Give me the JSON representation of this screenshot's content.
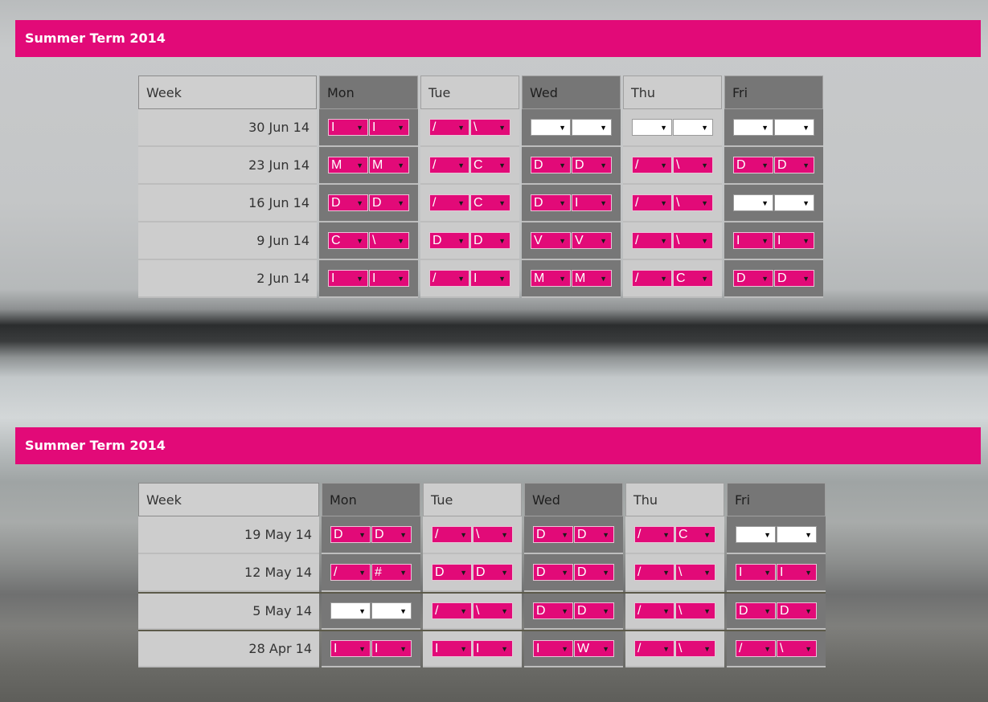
{
  "tables": [
    {
      "title": "Summer Term 2014",
      "headers": {
        "week": "Week",
        "days": [
          "Mon",
          "Tue",
          "Wed",
          "Thu",
          "Fri"
        ]
      },
      "rows": [
        {
          "week": "30 Jun 14",
          "days": [
            [
              "I",
              "I"
            ],
            [
              "/",
              "\\"
            ],
            [
              "",
              ""
            ],
            [
              "",
              ""
            ],
            [
              "",
              ""
            ]
          ]
        },
        {
          "week": "23 Jun 14",
          "days": [
            [
              "M",
              "M"
            ],
            [
              "/",
              "C"
            ],
            [
              "D",
              "D"
            ],
            [
              "/",
              "\\"
            ],
            [
              "D",
              "D"
            ]
          ]
        },
        {
          "week": "16 Jun 14",
          "days": [
            [
              "D",
              "D"
            ],
            [
              "/",
              "C"
            ],
            [
              "D",
              "I"
            ],
            [
              "/",
              "\\"
            ],
            [
              "",
              ""
            ]
          ]
        },
        {
          "week": "9 Jun 14",
          "days": [
            [
              "C",
              "\\"
            ],
            [
              "D",
              "D"
            ],
            [
              "V",
              "V"
            ],
            [
              "/",
              "\\"
            ],
            [
              "I",
              "I"
            ]
          ]
        },
        {
          "week": "2 Jun 14",
          "days": [
            [
              "I",
              "I"
            ],
            [
              "/",
              "I"
            ],
            [
              "M",
              "M"
            ],
            [
              "/",
              "C"
            ],
            [
              "D",
              "D"
            ]
          ]
        }
      ]
    },
    {
      "title": "Summer Term 2014",
      "headers": {
        "week": "Week",
        "days": [
          "Mon",
          "Tue",
          "Wed",
          "Thu",
          "Fri"
        ]
      },
      "rows": [
        {
          "week": "19 May 14",
          "days": [
            [
              "D",
              "D"
            ],
            [
              "/",
              "\\"
            ],
            [
              "D",
              "D"
            ],
            [
              "/",
              "C"
            ],
            [
              "",
              ""
            ]
          ]
        },
        {
          "week": "12 May 14",
          "days": [
            [
              "/",
              "#"
            ],
            [
              "D",
              "D"
            ],
            [
              "D",
              "D"
            ],
            [
              "/",
              "\\"
            ],
            [
              "I",
              "I"
            ]
          ]
        },
        {
          "week": "5 May 14",
          "days": [
            [
              "",
              ""
            ],
            [
              "/",
              "\\"
            ],
            [
              "D",
              "D"
            ],
            [
              "/",
              "\\"
            ],
            [
              "D",
              "D"
            ]
          ]
        },
        {
          "week": "28 Apr 14",
          "days": [
            [
              "I",
              "I"
            ],
            [
              "I",
              "I"
            ],
            [
              "I",
              "W"
            ],
            [
              "/",
              "\\"
            ],
            [
              "/",
              "\\"
            ]
          ]
        }
      ]
    }
  ],
  "dropdown_arrow": "▼",
  "colors": {
    "accent": "#e20a78",
    "dark_column": "#777777",
    "light_column": "#cbcbcb"
  }
}
